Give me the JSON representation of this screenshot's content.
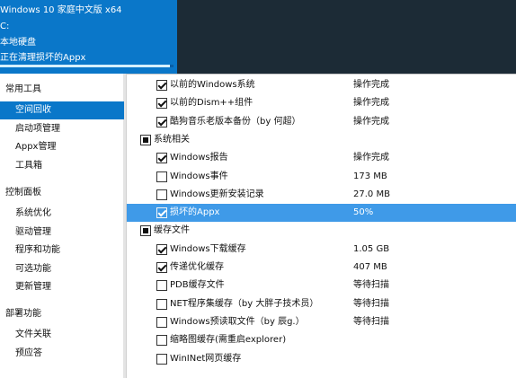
{
  "header": {
    "line1": "Windows 10 家庭中文版 x64",
    "line2": "C:",
    "line3": "本地硬盘",
    "line4": "正在清理损坏的Appx",
    "progress": 0.98
  },
  "sidebar": {
    "groups": [
      {
        "label": "常用工具",
        "items": [
          {
            "label": "空间回收",
            "selected": true
          },
          {
            "label": "启动项管理"
          },
          {
            "label": "Appx管理"
          },
          {
            "label": "工具箱"
          }
        ]
      },
      {
        "label": "控制面板",
        "items": [
          {
            "label": "系统优化"
          },
          {
            "label": "驱动管理"
          },
          {
            "label": "程序和功能"
          },
          {
            "label": "可选功能"
          },
          {
            "label": "更新管理"
          }
        ]
      },
      {
        "label": "部署功能",
        "items": [
          {
            "label": "文件关联"
          },
          {
            "label": "预应答"
          }
        ]
      }
    ]
  },
  "list": {
    "rows": [
      {
        "type": "item",
        "label": "以前的Windows系统",
        "status": "操作完成",
        "checked": true
      },
      {
        "type": "item",
        "label": "以前的Dism++组件",
        "status": "操作完成",
        "checked": true
      },
      {
        "type": "item",
        "label": "酷狗音乐老版本备份（by 何超）",
        "status": "操作完成",
        "checked": true
      },
      {
        "type": "group",
        "label": "系统相关"
      },
      {
        "type": "item",
        "label": "Windows报告",
        "status": "操作完成",
        "checked": true
      },
      {
        "type": "item",
        "label": "Windows事件",
        "status": "173 MB",
        "checked": false
      },
      {
        "type": "item",
        "label": "Windows更新安装记录",
        "status": "27.0 MB",
        "checked": false
      },
      {
        "type": "item",
        "label": "损坏的Appx",
        "status": "50%",
        "checked": true,
        "selected": true
      },
      {
        "type": "group",
        "label": "缓存文件"
      },
      {
        "type": "item",
        "label": "Windows下载缓存",
        "status": "1.05 GB",
        "checked": true
      },
      {
        "type": "item",
        "label": "传递优化缓存",
        "status": "407 MB",
        "checked": true
      },
      {
        "type": "item",
        "label": "PDB缓存文件",
        "status": "等待扫描",
        "checked": false
      },
      {
        "type": "item",
        "label": "NET程序集缓存（by 大胖子技术员）",
        "status": "等待扫描",
        "checked": false
      },
      {
        "type": "item",
        "label": "Windows预读取文件（by 辰g.）",
        "status": "等待扫描",
        "checked": false
      },
      {
        "type": "item",
        "label": "缩略图缓存(需重启explorer)",
        "status": "",
        "checked": false
      },
      {
        "type": "item",
        "label": "WinINet网页缓存",
        "status": "",
        "checked": false
      }
    ]
  }
}
